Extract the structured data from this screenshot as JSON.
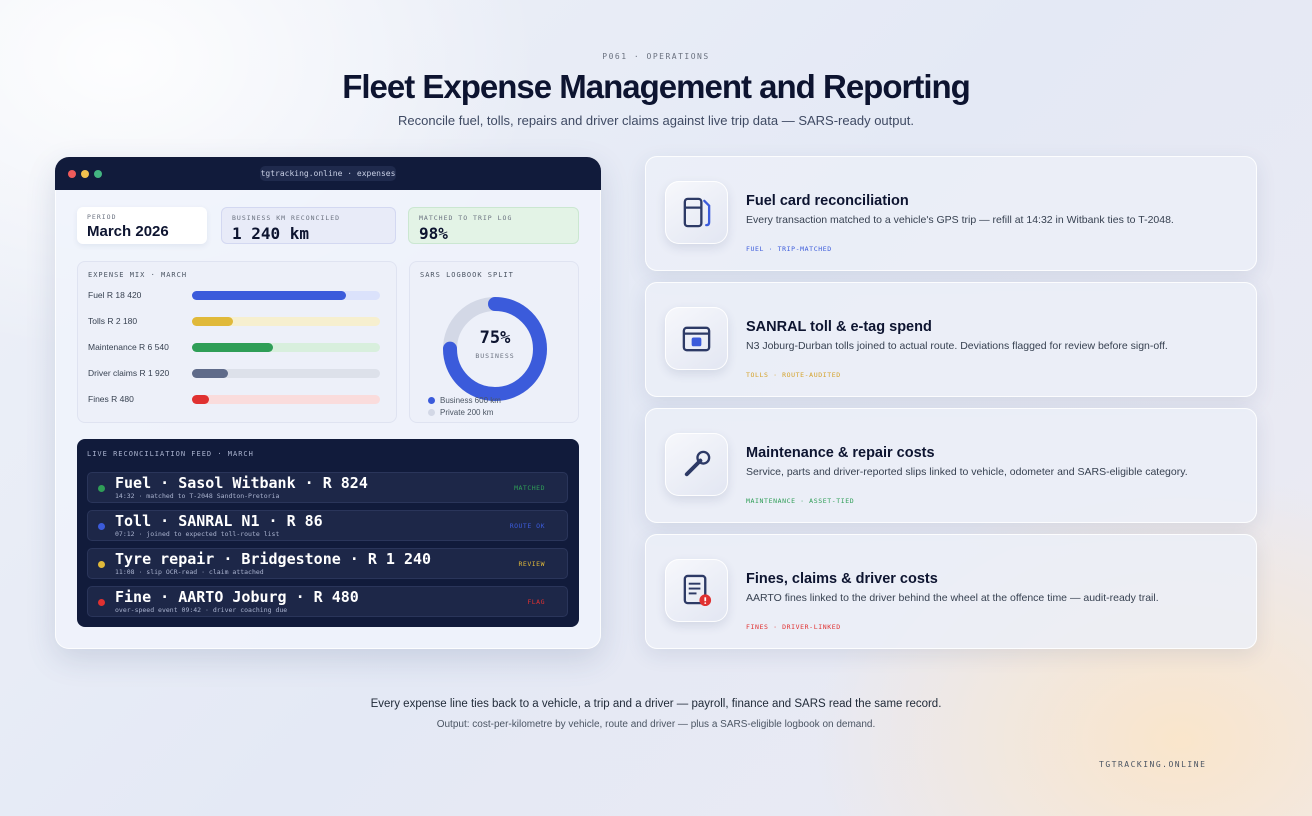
{
  "header": {
    "eyebrow": "P061 · OPERATIONS",
    "title": "Fleet Expense Management and Reporting",
    "subtitle": "Reconcile fuel, tolls, repairs and driver claims against live trip data — SARS-ready output."
  },
  "app": {
    "url": "tgtracking.online · expenses",
    "stats": {
      "period_label": "PERIOD",
      "period_value": "March 2026",
      "business_label": "BUSINESS KM RECONCILED",
      "business_value": "1 240 km",
      "matched_label": "MATCHED TO TRIP LOG",
      "matched_value": "98%"
    },
    "expense_mix": {
      "heading": "EXPENSE MIX · MARCH",
      "items": [
        {
          "label": "Fuel R 18 420",
          "fraction": 0.82,
          "color": "#3b5bdb",
          "track": "#dbe2fb"
        },
        {
          "label": "Tolls R 2 180",
          "fraction": 0.22,
          "color": "#e0b93a",
          "track": "#f6efcf"
        },
        {
          "label": "Maintenance R 6 540",
          "fraction": 0.43,
          "color": "#2f9e57",
          "track": "#d8efdd"
        },
        {
          "label": "Driver claims R 1 920",
          "fraction": 0.19,
          "color": "#5f6b8a",
          "track": "#dde1ea"
        },
        {
          "label": "Fines R 480",
          "fraction": 0.09,
          "color": "#e03131",
          "track": "#fadcdc"
        }
      ]
    },
    "logbook": {
      "heading": "SARS LOGBOOK SPLIT",
      "business_pct": 75,
      "pct_text": "75%",
      "caption": "BUSINESS",
      "legend_business": "Business 600 km",
      "legend_private": "Private 200 km",
      "color_business": "#3b5bdb",
      "color_private": "#d3d8e6"
    },
    "feed": {
      "heading": "LIVE RECONCILIATION FEED · MARCH",
      "rows": [
        {
          "main": "Fuel · Sasol Witbank · R 824",
          "sub": "14:32 · matched to T-2048 Sandton-Pretoria",
          "tag": "MATCHED",
          "color": "#2f9e57"
        },
        {
          "main": "Toll · SANRAL N1 · R 86",
          "sub": "07:12 · joined to expected toll-route list",
          "tag": "ROUTE OK",
          "color": "#3b5bdb"
        },
        {
          "main": "Tyre repair · Bridgestone · R 1 240",
          "sub": "11:08 · slip OCR-read · claim attached",
          "tag": "REVIEW",
          "color": "#e0b93a"
        },
        {
          "main": "Fine · AARTO Joburg · R 480",
          "sub": "over-speed event 09:42 · driver coaching due",
          "tag": "FLAG",
          "color": "#e03131"
        }
      ]
    }
  },
  "cards": [
    {
      "title": "Fuel card reconciliation",
      "desc": "Every transaction matched to a vehicle's GPS trip — refill at 14:32 in Witbank ties to T-2048.",
      "tags": "FUEL · TRIP-MATCHED",
      "tag_color": "#3b5bdb",
      "icon": "fuel-pump-icon"
    },
    {
      "title": "SANRAL toll & e-tag spend",
      "desc": "N3 Joburg-Durban tolls joined to actual route. Deviations flagged for review before sign-off.",
      "tags": "TOLLS · ROUTE-AUDITED",
      "tag_color": "#d4a22a",
      "icon": "toll-tag-icon"
    },
    {
      "title": "Maintenance & repair costs",
      "desc": "Service, parts and driver-reported slips linked to vehicle, odometer and SARS-eligible category.",
      "tags": "MAINTENANCE · ASSET-TIED",
      "tag_color": "#2f9e57",
      "icon": "wrench-icon"
    },
    {
      "title": "Fines, claims & driver costs",
      "desc": "AARTO fines linked to the driver behind the wheel at the offence time — audit-ready trail.",
      "tags": "FINES · DRIVER-LINKED",
      "tag_color": "#e03131",
      "icon": "document-alert-icon"
    }
  ],
  "footer": {
    "line1": "Every expense line ties back to a vehicle, a trip and a driver — payroll, finance and SARS read the same record.",
    "line2": "Output: cost-per-kilometre by vehicle, route and driver — plus a SARS-eligible logbook on demand.",
    "brand": "TGTRACKING.ONLINE"
  }
}
